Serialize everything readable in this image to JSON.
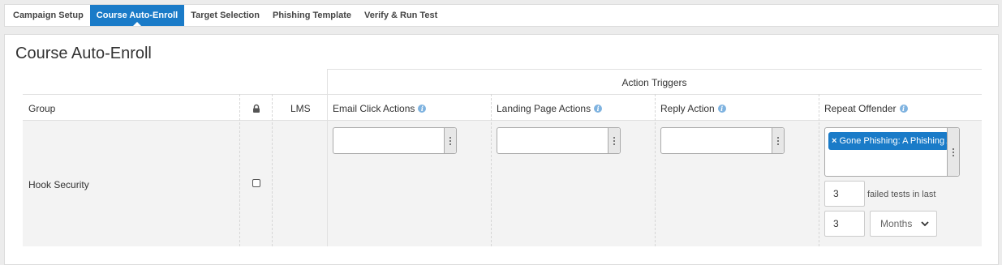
{
  "tabs": [
    {
      "label": "Campaign Setup",
      "active": false
    },
    {
      "label": "Course Auto-Enroll",
      "active": true
    },
    {
      "label": "Target Selection",
      "active": false
    },
    {
      "label": "Phishing Template",
      "active": false
    },
    {
      "label": "Verify & Run Test",
      "active": false
    }
  ],
  "page": {
    "title": "Course Auto-Enroll"
  },
  "table": {
    "group_header": "Action Triggers",
    "columns": {
      "group": "Group",
      "lms": "LMS",
      "email_click": "Email Click Actions",
      "landing_page": "Landing Page Actions",
      "reply": "Reply Action",
      "repeat_offender": "Repeat Offender"
    },
    "rows": [
      {
        "group": "Hook Security",
        "checked": false,
        "repeat_offender": {
          "selected_course": "Gone Phishing: A Phishing Awareness Course",
          "chip_remove": "×",
          "failed_count": "3",
          "failed_label": "failed tests in last",
          "period_count": "3",
          "period_unit": "Months"
        }
      }
    ]
  },
  "colors": {
    "accent": "#1a7bc8",
    "info_icon": "#7fb3e0",
    "row_bg": "#f3f3f3"
  },
  "icons": {
    "lock": "lock-icon",
    "info": "info-icon",
    "dropdown": "kebab-icon",
    "chevron": "chevron-down-icon"
  }
}
